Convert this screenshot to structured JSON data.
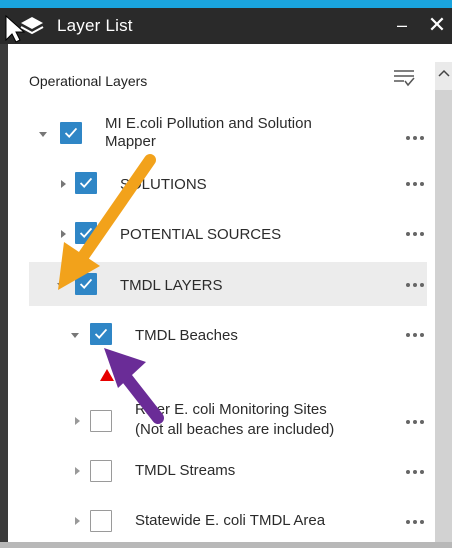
{
  "window": {
    "title": "Layer List",
    "minimize_glyph": "–",
    "close_glyph": "✕"
  },
  "panel": {
    "section_title": "Operational Layers"
  },
  "layers": [
    {
      "label": "MI E.coli Pollution and Solution",
      "label2": "Mapper",
      "checked": true,
      "expanded": true,
      "level": 0
    },
    {
      "label": "SOLUTIONS",
      "checked": true,
      "expanded": false,
      "level": 1
    },
    {
      "label": "POTENTIAL SOURCES",
      "checked": true,
      "expanded": false,
      "level": 1
    },
    {
      "label": "TMDL LAYERS",
      "checked": true,
      "expanded": true,
      "level": 1,
      "highlighted": true
    },
    {
      "label": "TMDL Beaches",
      "checked": true,
      "expanded": true,
      "level": 2
    },
    {
      "label": "River E. coli Monitoring Sites",
      "label2": "(Not all beaches are included)",
      "checked": false,
      "expanded": false,
      "level": 2
    },
    {
      "label": "TMDL Streams",
      "checked": false,
      "expanded": false,
      "level": 2
    },
    {
      "label": "Statewide E. coli TMDL Area",
      "checked": false,
      "expanded": false,
      "level": 2
    }
  ],
  "icons": {
    "title": "layers-icon",
    "filter": "filter-list-icon",
    "more": "ellipsis-icon",
    "expand": "triangle-expander-icon",
    "legend_symbol": "red-triangle-icon"
  },
  "colors": {
    "title_bar": "#2a2a2a",
    "accent_strip": "#1aa4de",
    "checkbox_checked": "#2f86c6",
    "highlight_row": "#ececec",
    "annotation_orange": "#f2a21b",
    "annotation_purple": "#6a2c97",
    "legend_triangle": "#e60000"
  }
}
